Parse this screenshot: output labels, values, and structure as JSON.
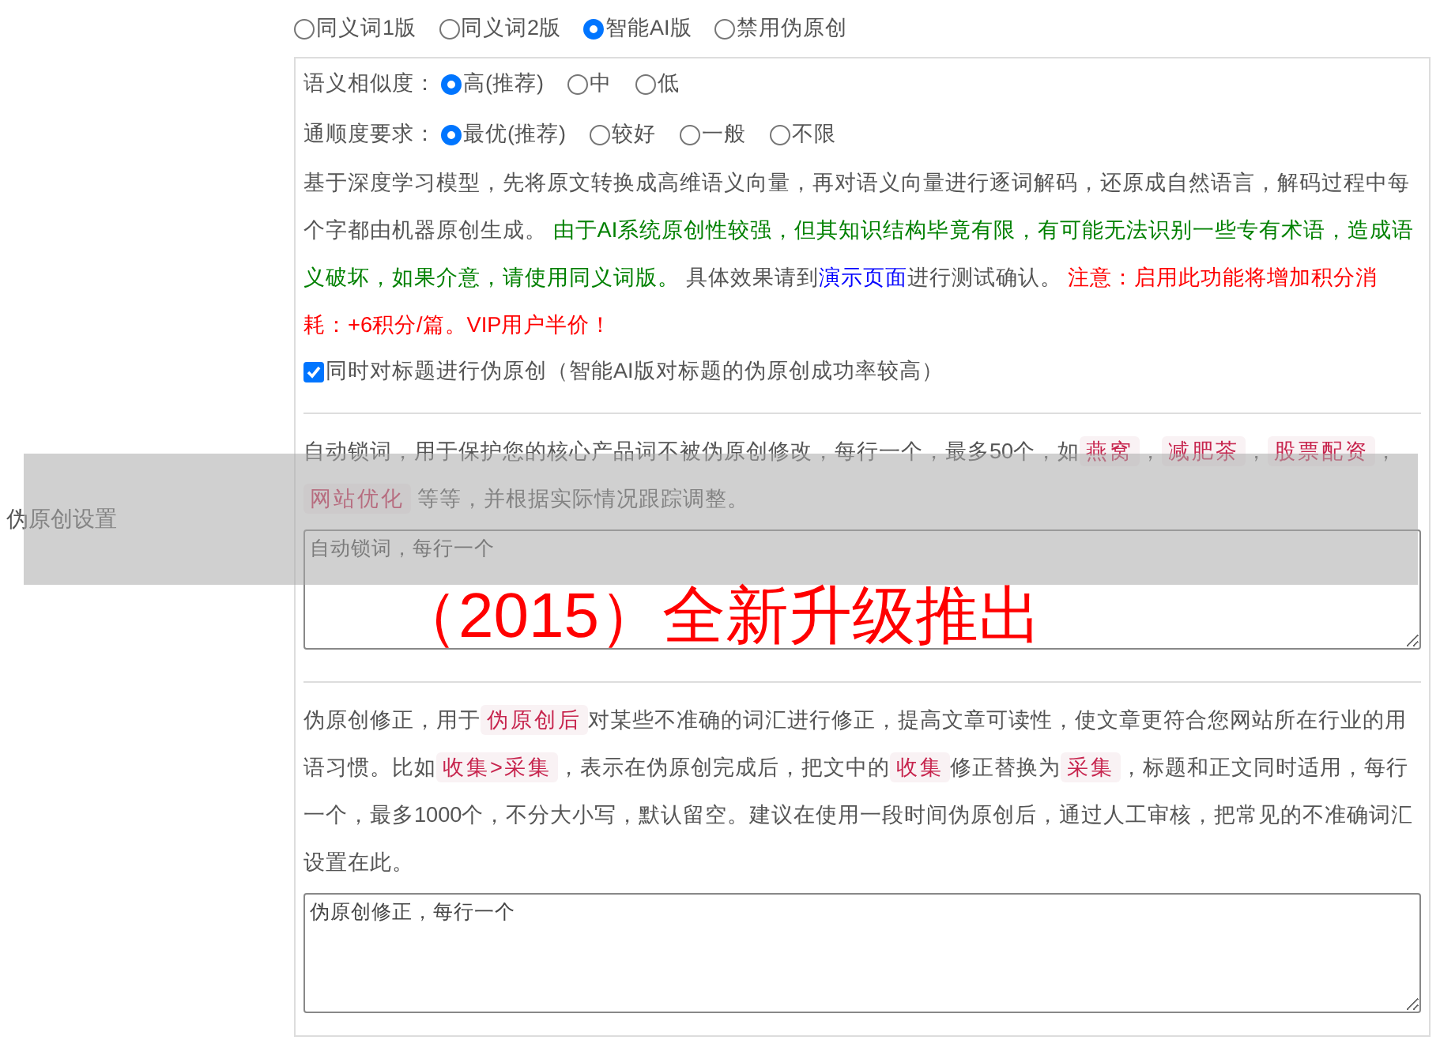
{
  "section_label": "伪原创设置",
  "modes": [
    {
      "label": "同义词1版",
      "selected": false
    },
    {
      "label": "同义词2版",
      "selected": false
    },
    {
      "label": "智能AI版",
      "selected": true
    },
    {
      "label": "禁用伪原创",
      "selected": false
    }
  ],
  "option_groups": [
    {
      "label": "语义相似度：",
      "options": [
        {
          "label": "高(推荐)",
          "selected": true
        },
        {
          "label": "中",
          "selected": false
        },
        {
          "label": "低",
          "selected": false
        }
      ]
    },
    {
      "label": "通顺度要求：",
      "options": [
        {
          "label": "最优(推荐)",
          "selected": true
        },
        {
          "label": "较好",
          "selected": false
        },
        {
          "label": "一般",
          "selected": false
        },
        {
          "label": "不限",
          "selected": false
        }
      ]
    }
  ],
  "description": [
    {
      "kind": "plain",
      "text": "基于深度学习模型，先将原文转换成高维语义向量，再对语义向量进行逐词解码，还原成自然语言，解码过程中每个字都由机器原创生成。 "
    },
    {
      "kind": "green",
      "text": "由于AI系统原创性较强，但其知识结构毕竟有限，有可能无法识别一些专有术语，造成语义破坏，如果介意，请使用同义词版。"
    },
    {
      "kind": "plain",
      "text": " 具体效果请到"
    },
    {
      "kind": "link",
      "text": "演示页面"
    },
    {
      "kind": "plain",
      "text": "进行测试确认。 "
    },
    {
      "kind": "red",
      "text": "注意：启用此功能将增加积分消耗：+6积分/篇。VIP用户半价！"
    }
  ],
  "title_option": {
    "label": "同时对标题进行伪原创（智能AI版对标题的伪原创成功率较高）",
    "checked": true
  },
  "lock_words": {
    "description": [
      {
        "kind": "plain",
        "text": "自动锁词，用于保护您的核心产品词不被伪原创修改，每行一个，最多50个，如"
      },
      {
        "kind": "code",
        "text": "燕窝"
      },
      {
        "kind": "plain",
        "text": "，"
      },
      {
        "kind": "code",
        "text": "减肥茶"
      },
      {
        "kind": "plain",
        "text": "，"
      },
      {
        "kind": "code",
        "text": "股票配资"
      },
      {
        "kind": "plain",
        "text": "，"
      },
      {
        "kind": "code",
        "text": "网站优化"
      },
      {
        "kind": "plain",
        "text": " 等等，并根据实际情况跟踪调整。"
      }
    ],
    "placeholder": "自动锁词，每行一个"
  },
  "corrections": {
    "description": [
      {
        "kind": "plain",
        "text": "伪原创修正，用于"
      },
      {
        "kind": "code",
        "text": "伪原创后"
      },
      {
        "kind": "plain",
        "text": "对某些不准确的词汇进行修正，提高文章可读性，使文章更符合您网站所在行业的用语习惯。比如"
      },
      {
        "kind": "code",
        "text": "收集>采集"
      },
      {
        "kind": "plain",
        "text": "，表示在伪原创完成后，把文中的"
      },
      {
        "kind": "code",
        "text": "收集"
      },
      {
        "kind": "plain",
        "text": "修正替换为"
      },
      {
        "kind": "code",
        "text": "采集"
      },
      {
        "kind": "plain",
        "text": "，标题和正文同时适用，每行一个，最多1000个，不分大小写，默认留空。建议在使用一段时间伪原创后，通过人工审核，把常见的不准确词汇设置在此。"
      }
    ],
    "placeholder": "伪原创修正，每行一个"
  },
  "banner": {
    "text": "（2015）全新升级推出"
  }
}
